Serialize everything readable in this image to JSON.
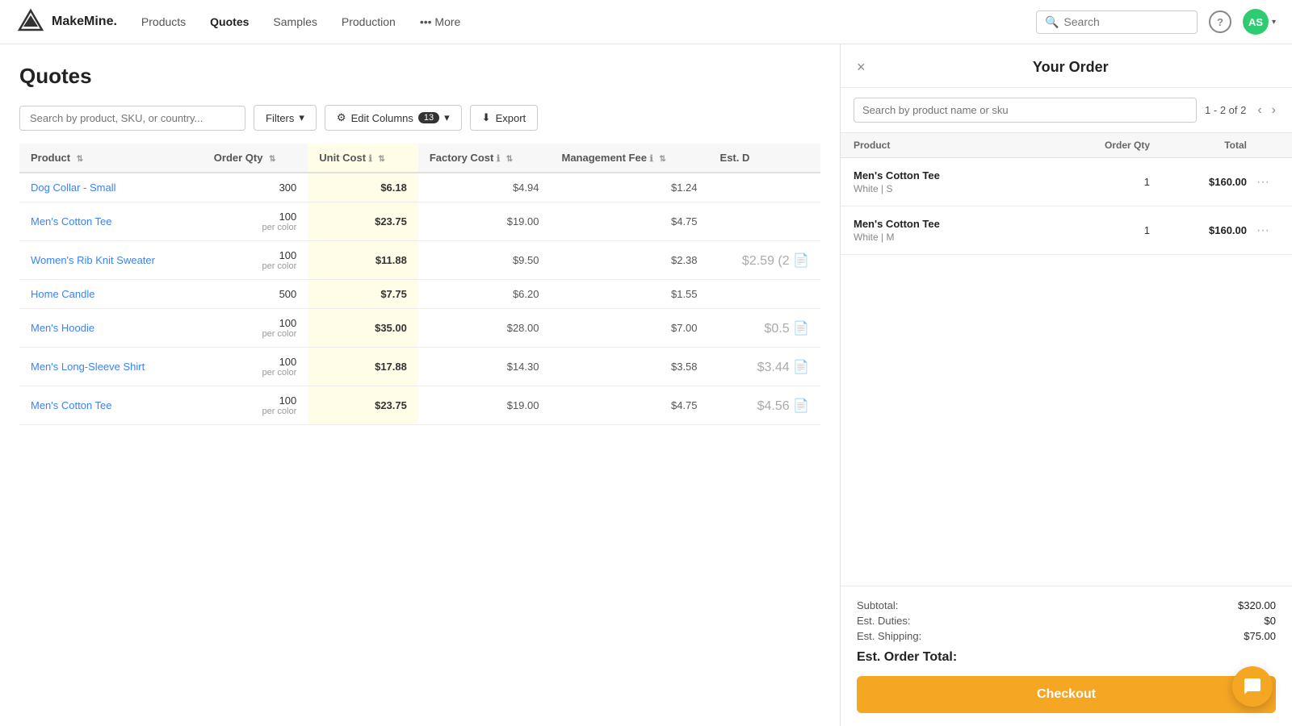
{
  "app": {
    "logo_text": "MakeMine.",
    "nav_links": [
      {
        "label": "Products",
        "active": false
      },
      {
        "label": "Quotes",
        "active": true
      },
      {
        "label": "Samples",
        "active": false
      },
      {
        "label": "Production",
        "active": false
      },
      {
        "label": "••• More",
        "active": false
      }
    ],
    "search_placeholder": "Search",
    "avatar_initials": "AS"
  },
  "left": {
    "page_title": "Quotes",
    "search_placeholder": "Search by product, SKU, or country...",
    "filters_label": "Filters",
    "edit_columns_label": "Edit Columns",
    "edit_columns_count": "13",
    "export_label": "Export",
    "table": {
      "headers": [
        {
          "label": "Product",
          "sortable": true
        },
        {
          "label": "Order Qty",
          "sortable": true
        },
        {
          "label": "Unit Cost",
          "sortable": true,
          "info": true
        },
        {
          "label": "Factory Cost",
          "sortable": true,
          "info": true
        },
        {
          "label": "Management Fee",
          "sortable": true,
          "info": true
        },
        {
          "label": "Est. D",
          "sortable": false
        }
      ],
      "rows": [
        {
          "product": "Dog Collar - Small",
          "qty": "300",
          "qty_sub": "",
          "unit_cost": "$6.18",
          "factory_cost": "$4.94",
          "mgmt_fee": "$1.24",
          "est_d": "",
          "has_doc": false
        },
        {
          "product": "Men's Cotton Tee",
          "qty": "100",
          "qty_sub": "per color",
          "unit_cost": "$23.75",
          "factory_cost": "$19.00",
          "mgmt_fee": "$4.75",
          "est_d": "",
          "has_doc": false
        },
        {
          "product": "Women's Rib Knit Sweater",
          "qty": "100",
          "qty_sub": "per color",
          "unit_cost": "$11.88",
          "factory_cost": "$9.50",
          "mgmt_fee": "$2.38",
          "est_d": "$2.59 (2",
          "has_doc": true
        },
        {
          "product": "Home Candle",
          "qty": "500",
          "qty_sub": "",
          "unit_cost": "$7.75",
          "factory_cost": "$6.20",
          "mgmt_fee": "$1.55",
          "est_d": "",
          "has_doc": false
        },
        {
          "product": "Men's Hoodie",
          "qty": "100",
          "qty_sub": "per color",
          "unit_cost": "$35.00",
          "factory_cost": "$28.00",
          "mgmt_fee": "$7.00",
          "est_d": "$0.5",
          "has_doc": true
        },
        {
          "product": "Men's Long-Sleeve Shirt",
          "qty": "100",
          "qty_sub": "per color",
          "unit_cost": "$17.88",
          "factory_cost": "$14.30",
          "mgmt_fee": "$3.58",
          "est_d": "$3.44",
          "has_doc": true
        },
        {
          "product": "Men's Cotton Tee",
          "qty": "100",
          "qty_sub": "per color",
          "unit_cost": "$23.75",
          "factory_cost": "$19.00",
          "mgmt_fee": "$4.75",
          "est_d": "$4.56",
          "has_doc": true
        }
      ]
    }
  },
  "right": {
    "title": "Your Order",
    "close_label": "×",
    "search_placeholder": "Search by product name or sku",
    "pagination": "1 - 2 of 2",
    "columns": [
      {
        "label": "Product"
      },
      {
        "label": "Order Qty"
      },
      {
        "label": "Total"
      }
    ],
    "items": [
      {
        "name": "Men's Cotton Tee",
        "variant": "White | S",
        "qty": "1",
        "total": "$160.00"
      },
      {
        "name": "Men's Cotton Tee",
        "variant": "White | M",
        "qty": "1",
        "total": "$160.00"
      }
    ],
    "summary": {
      "subtotal_label": "Subtotal:",
      "subtotal_value": "$320.00",
      "duties_label": "Est. Duties:",
      "duties_value": "$0",
      "shipping_label": "Est. Shipping:",
      "shipping_value": "$75.00"
    },
    "est_total_label": "Est. Order Total:",
    "est_total_value": "",
    "checkout_label": "Checkout"
  }
}
